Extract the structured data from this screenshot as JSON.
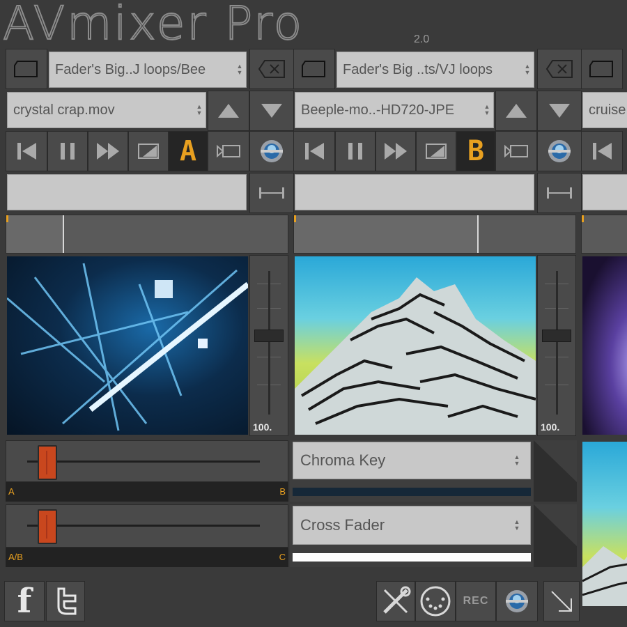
{
  "app": {
    "title": "AVmixer Pro",
    "version": "2.0"
  },
  "decks": [
    {
      "folder": "Fader's Big..J loops/Bee",
      "file": "crystal crap.mov",
      "letter": "A",
      "progress": 0.2,
      "opacity": "100."
    },
    {
      "folder": "Fader's Big ..ts/VJ loops",
      "file": "Beeple-mo..-HD720-JPE",
      "letter": "B",
      "progress": 0.65,
      "opacity": "100."
    },
    {
      "file": "cruise"
    }
  ],
  "mixer": {
    "top_slider": {
      "left_label": "A",
      "right_label": "B",
      "position": 0.05
    },
    "bottom_slider": {
      "left_label": "A/B",
      "right_label": "C",
      "position": 0.05
    },
    "effect_select": "Chroma Key",
    "fader_select": "Cross Fader",
    "fader_level": 1.0
  },
  "bottom": {
    "rec_label": "REC"
  },
  "colors": {
    "accent": "#e8a020",
    "knob": "#c9471e",
    "panel": "#4a4a4a"
  }
}
